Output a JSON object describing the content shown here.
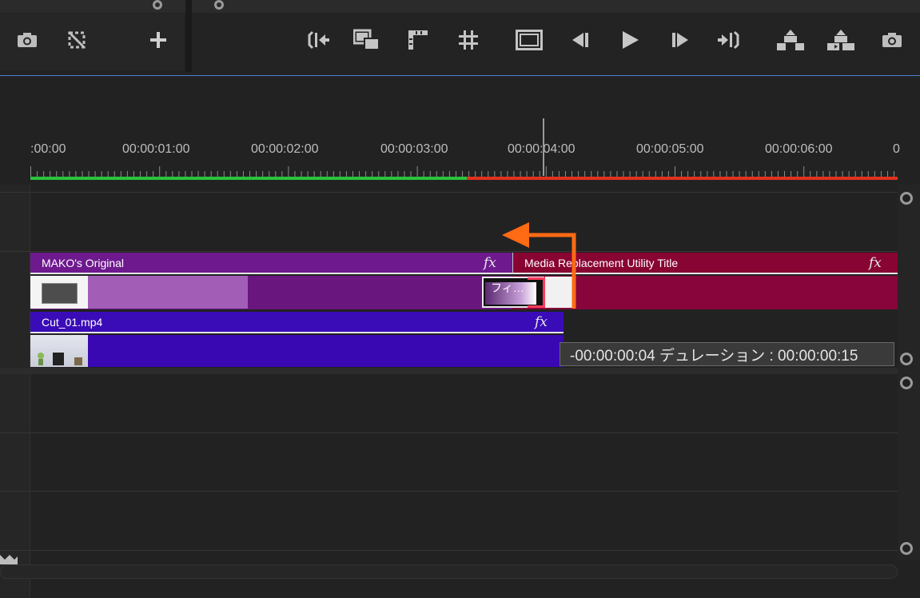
{
  "toolbar": {
    "left_icons": [
      "camera-icon",
      "sync-lock-off-icon",
      "plus-icon"
    ],
    "right_icons": [
      "go-to-in-icon",
      "insert-clip-icon",
      "mark-in-icon",
      "trim-icon",
      "safe-margins-icon",
      "step-back-icon",
      "play-icon",
      "step-forward-icon",
      "go-to-out-icon",
      "lift-icon",
      "extract-icon",
      "export-frame-icon"
    ]
  },
  "ruler": {
    "timecodes": [
      ":00:00",
      "00:00:01:00",
      "00:00:02:00",
      "00:00:03:00",
      "00:00:04:00",
      "00:00:05:00",
      "00:00:06:00",
      "0"
    ]
  },
  "clips": {
    "mako_original": {
      "label": "MAKO's Original",
      "fx": "fx"
    },
    "media_replacement": {
      "label": "Media Replacement Utility Title",
      "fx": "fx"
    },
    "cut_01": {
      "label": "Cut_01.mp4",
      "fx": "fx"
    },
    "transition": {
      "label": "フィ…"
    }
  },
  "tooltip": {
    "text": "-00:00:00:04 デュレーション : 00:00:00:15"
  },
  "colors": {
    "annotation_arrow": "#ff6a14",
    "render_bar_green": "#29c43c",
    "render_bar_red": "#e2311f"
  }
}
